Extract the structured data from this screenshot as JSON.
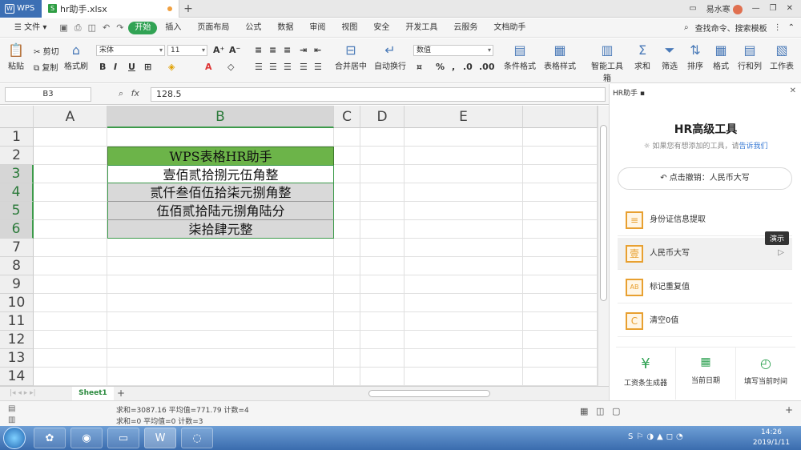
{
  "titlebar": {
    "app": "WPS",
    "doc_tab": "hr助手.xlsx",
    "user": "易水寒",
    "window_controls": [
      "minimize-icon",
      "restore-icon",
      "close-icon"
    ]
  },
  "menubar": {
    "file": "文件",
    "tabs": [
      "开始",
      "插入",
      "页面布局",
      "公式",
      "数据",
      "审阅",
      "视图",
      "安全",
      "开发工具",
      "云服务",
      "文档助手"
    ],
    "active_tab": "开始",
    "search": "查找命令、搜索模板"
  },
  "ribbon": {
    "paste": "粘贴",
    "cut": "剪切",
    "copy": "复制",
    "format_painter": "格式刷",
    "font_name": "宋体",
    "font_size": "11",
    "merge": "合并居中",
    "wrap": "自动换行",
    "number_format": "数值",
    "conditional": "条件格式",
    "table_style": "表格样式",
    "smart_toolbox": "智能工具箱",
    "sum": "求和",
    "filter": "筛选",
    "sort": "排序",
    "format": "格式",
    "rows_cols": "行和列",
    "worksheet": "工作表"
  },
  "formula_bar": {
    "cell_ref": "B3",
    "fx": "fx",
    "value": "128.5"
  },
  "grid": {
    "columns": [
      "A",
      "B",
      "C",
      "D",
      "E"
    ],
    "rows": [
      "1",
      "2",
      "3",
      "4",
      "5",
      "6",
      "7",
      "8",
      "9",
      "10",
      "11",
      "12",
      "13",
      "14"
    ],
    "header_cell": "WPS表格HR助手",
    "values": [
      "壹佰贰拾捌元伍角整",
      "贰仟叁佰伍拾柒元捌角整",
      "伍佰贰拾陆元捌角陆分",
      "柒拾肆元整"
    ]
  },
  "sheet_tab": "Sheet1",
  "status": {
    "line1": "求和=3087.16  平均值=771.79  计数=4",
    "line2": "求和=0  平均值=0  计数=3"
  },
  "panel": {
    "header": "HR助手",
    "title": "HR高级工具",
    "subtitle_prefix": "如果您有想添加的工具，请",
    "subtitle_link": "告诉我们",
    "undo": "点击撤销：人民币大写",
    "tools": [
      {
        "label": "身份证信息提取",
        "icon": "id-card-icon",
        "glyph": "≡"
      },
      {
        "label": "人民币大写",
        "icon": "rmb-uppercase-icon",
        "glyph": "壹"
      },
      {
        "label": "标记重复值",
        "icon": "duplicate-mark-icon",
        "glyph": "AB"
      },
      {
        "label": "清空0值",
        "icon": "clear-zero-icon",
        "glyph": "C"
      }
    ],
    "tooltip": "演示",
    "bottom_tools": [
      "工资条生成器",
      "当前日期",
      "填写当前时间"
    ]
  },
  "taskbar": {
    "time": "14:26",
    "date": "2019/1/11"
  }
}
